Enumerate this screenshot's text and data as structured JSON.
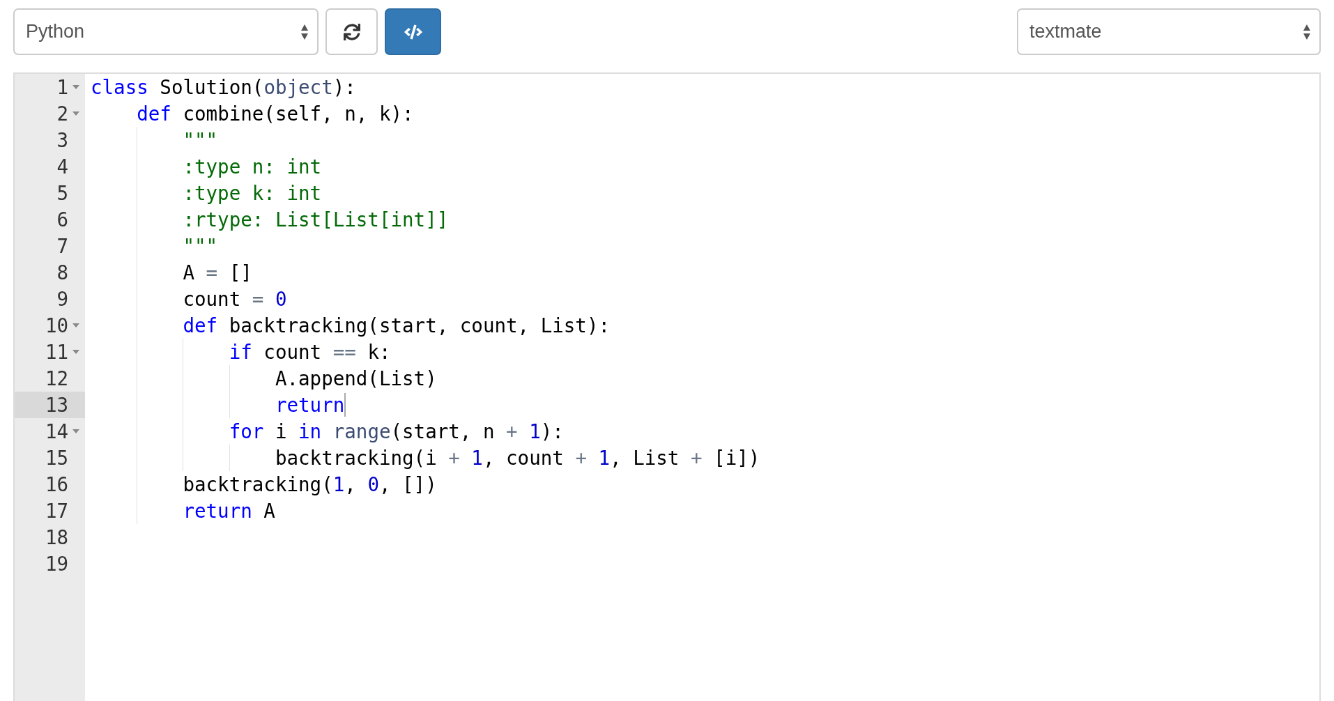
{
  "toolbar": {
    "language": "Python",
    "theme": "textmate"
  },
  "editor": {
    "lines": [
      {
        "number": "1",
        "foldable": true,
        "active": false,
        "tokens": [
          {
            "kind": "keyword",
            "text": "class"
          },
          {
            "kind": "plain",
            "text": " Solution("
          },
          {
            "kind": "builtin",
            "text": "object"
          },
          {
            "kind": "plain",
            "text": "):"
          }
        ]
      },
      {
        "number": "2",
        "foldable": true,
        "active": false,
        "tokens": [
          {
            "kind": "keyword",
            "text": "    def"
          },
          {
            "kind": "plain",
            "text": " combine(self, n, k):"
          }
        ]
      },
      {
        "number": "3",
        "foldable": false,
        "active": false,
        "tokens": [
          {
            "kind": "string",
            "text": "        \"\"\""
          }
        ]
      },
      {
        "number": "4",
        "foldable": false,
        "active": false,
        "tokens": [
          {
            "kind": "string",
            "text": "        :type n: int"
          }
        ]
      },
      {
        "number": "5",
        "foldable": false,
        "active": false,
        "tokens": [
          {
            "kind": "string",
            "text": "        :type k: int"
          }
        ]
      },
      {
        "number": "6",
        "foldable": false,
        "active": false,
        "tokens": [
          {
            "kind": "string",
            "text": "        :rtype: List[List[int]]"
          }
        ]
      },
      {
        "number": "7",
        "foldable": false,
        "active": false,
        "tokens": [
          {
            "kind": "string",
            "text": "        \"\"\""
          }
        ]
      },
      {
        "number": "8",
        "foldable": false,
        "active": false,
        "tokens": [
          {
            "kind": "plain",
            "text": "        A "
          },
          {
            "kind": "operator",
            "text": "="
          },
          {
            "kind": "plain",
            "text": " []"
          }
        ]
      },
      {
        "number": "9",
        "foldable": false,
        "active": false,
        "tokens": [
          {
            "kind": "plain",
            "text": "        count "
          },
          {
            "kind": "operator",
            "text": "="
          },
          {
            "kind": "number",
            "text": " 0"
          }
        ]
      },
      {
        "number": "10",
        "foldable": true,
        "active": false,
        "tokens": [
          {
            "kind": "keyword",
            "text": "        def"
          },
          {
            "kind": "plain",
            "text": " backtracking(start, count, List):"
          }
        ]
      },
      {
        "number": "11",
        "foldable": true,
        "active": false,
        "tokens": [
          {
            "kind": "keyword",
            "text": "            if"
          },
          {
            "kind": "plain",
            "text": " count "
          },
          {
            "kind": "operator",
            "text": "=="
          },
          {
            "kind": "plain",
            "text": " k:"
          }
        ]
      },
      {
        "number": "12",
        "foldable": false,
        "active": false,
        "tokens": [
          {
            "kind": "plain",
            "text": "                A.append(List)"
          }
        ]
      },
      {
        "number": "13",
        "foldable": false,
        "active": true,
        "tokens": [
          {
            "kind": "keyword",
            "text": "                return"
          }
        ]
      },
      {
        "number": "14",
        "foldable": true,
        "active": false,
        "tokens": [
          {
            "kind": "keyword",
            "text": "            for"
          },
          {
            "kind": "plain",
            "text": " i "
          },
          {
            "kind": "keyword",
            "text": "in"
          },
          {
            "kind": "builtin",
            "text": " range"
          },
          {
            "kind": "plain",
            "text": "(start, n "
          },
          {
            "kind": "operator",
            "text": "+"
          },
          {
            "kind": "number",
            "text": " 1"
          },
          {
            "kind": "plain",
            "text": "):"
          }
        ]
      },
      {
        "number": "15",
        "foldable": false,
        "active": false,
        "tokens": [
          {
            "kind": "plain",
            "text": "                backtracking(i "
          },
          {
            "kind": "operator",
            "text": "+"
          },
          {
            "kind": "number",
            "text": " 1"
          },
          {
            "kind": "plain",
            "text": ", count "
          },
          {
            "kind": "operator",
            "text": "+"
          },
          {
            "kind": "number",
            "text": " 1"
          },
          {
            "kind": "plain",
            "text": ", List "
          },
          {
            "kind": "operator",
            "text": "+"
          },
          {
            "kind": "plain",
            "text": " [i])"
          }
        ]
      },
      {
        "number": "16",
        "foldable": false,
        "active": false,
        "tokens": [
          {
            "kind": "plain",
            "text": "        backtracking("
          },
          {
            "kind": "number",
            "text": "1"
          },
          {
            "kind": "plain",
            "text": ", "
          },
          {
            "kind": "number",
            "text": "0"
          },
          {
            "kind": "plain",
            "text": ", [])"
          }
        ]
      },
      {
        "number": "17",
        "foldable": false,
        "active": false,
        "tokens": [
          {
            "kind": "keyword",
            "text": "        return"
          },
          {
            "kind": "plain",
            "text": " A"
          }
        ]
      },
      {
        "number": "18",
        "foldable": false,
        "active": false
      },
      {
        "number": "19",
        "foldable": false,
        "active": false
      }
    ]
  }
}
